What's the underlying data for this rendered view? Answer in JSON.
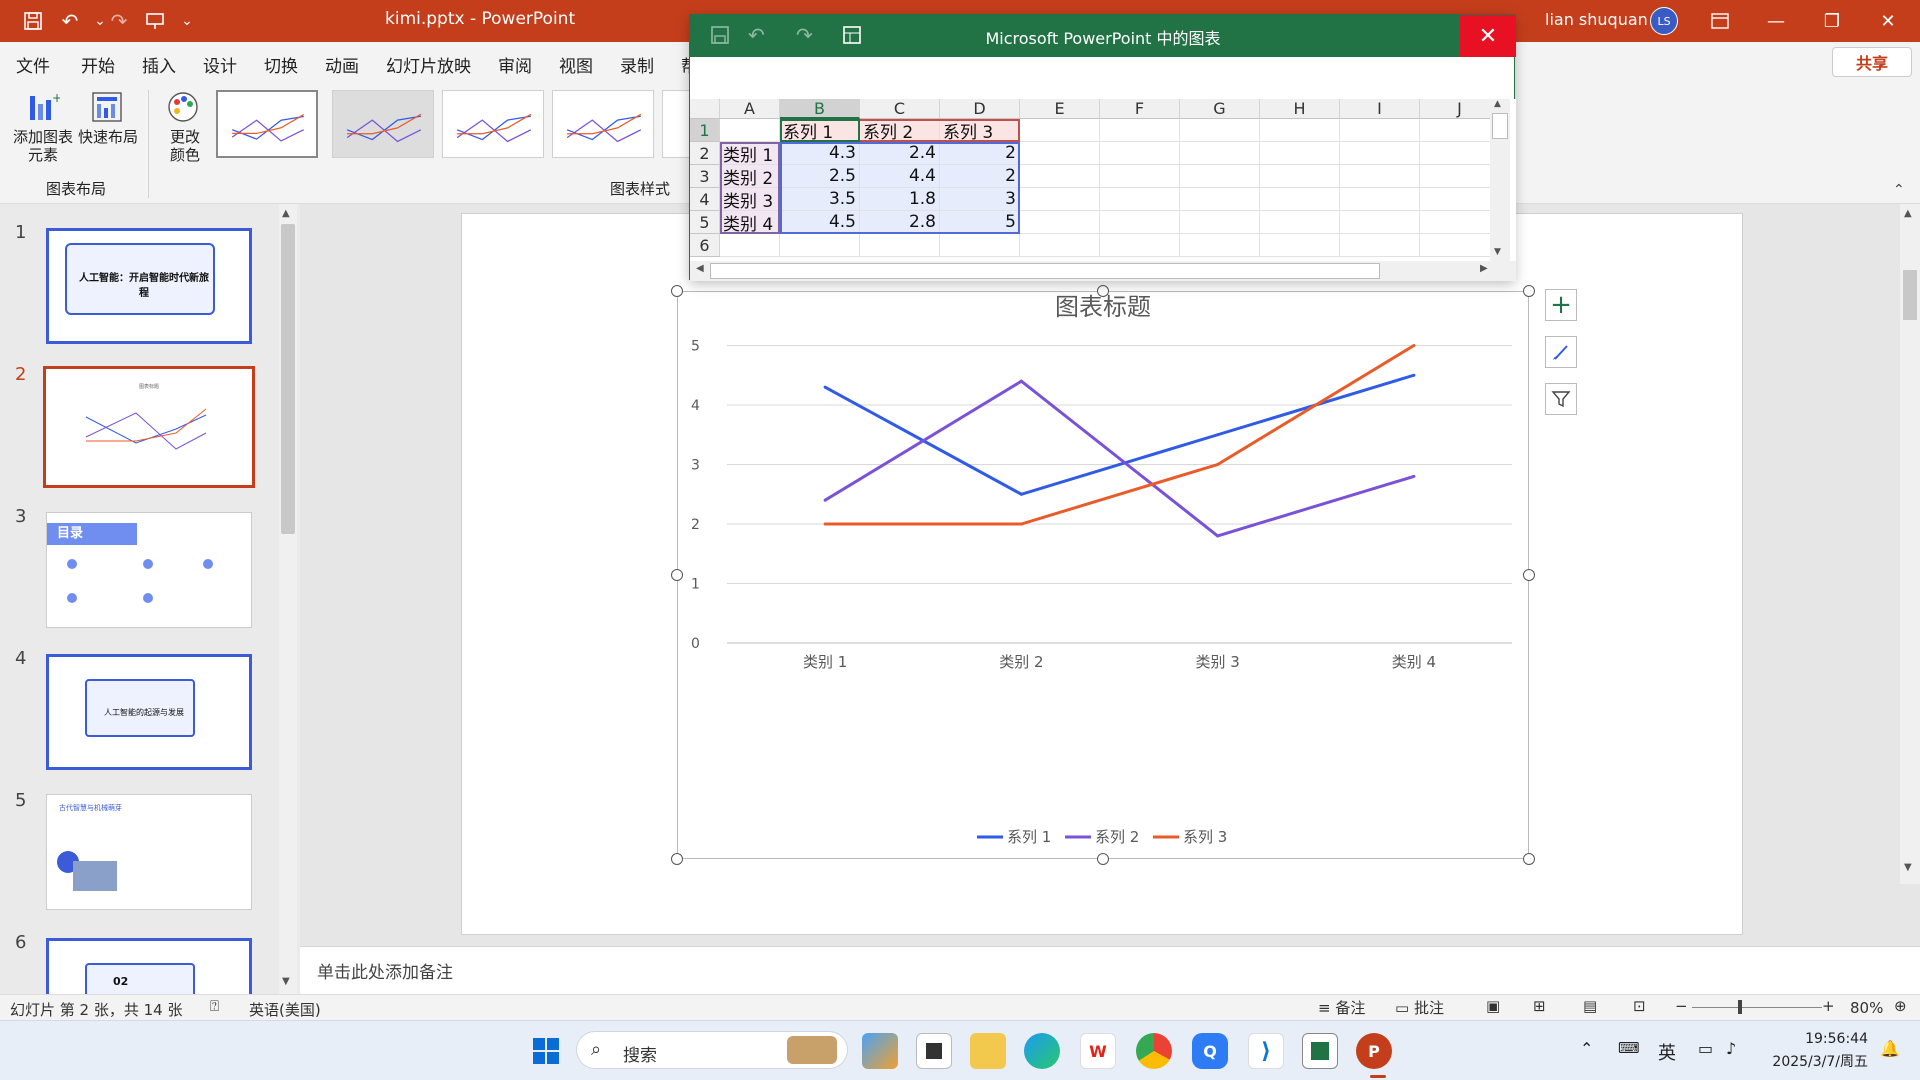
{
  "app": {
    "doc_title": "kimi.pptx  -  PowerPoint",
    "user_name": "lian shuquan",
    "user_initials": "LS",
    "accent": "#c43e1c"
  },
  "menu": [
    "文件",
    "开始",
    "插入",
    "设计",
    "切换",
    "动画",
    "幻灯片放映",
    "审阅",
    "视图",
    "录制",
    "帮"
  ],
  "share_label": "共享",
  "ribbon": {
    "add_element": "添加图表\n元素",
    "quick_layout": "快速布局",
    "change_color": "更改\n颜色",
    "group_layout": "图表布局",
    "group_style": "图表样式"
  },
  "slides": [
    {
      "num": "1",
      "title": "人工智能：开启智能时代新旅程"
    },
    {
      "num": "2",
      "title": "图表标题"
    },
    {
      "num": "3",
      "title": "目录"
    },
    {
      "num": "4",
      "title": "人工智能的起源与发展"
    },
    {
      "num": "5",
      "title": "古代智慧与机械萌芽"
    },
    {
      "num": "6",
      "title": "02"
    }
  ],
  "notes_placeholder": "单击此处添加备注",
  "status": {
    "slide_info": "幻灯片 第 2 张，共 14 张",
    "language": "英语(美国)",
    "notes": "备注",
    "comments": "批注",
    "zoom": "80%"
  },
  "excel": {
    "title": "Microsoft PowerPoint 中的图表",
    "columns": [
      "A",
      "B",
      "C",
      "D",
      "E",
      "F",
      "G",
      "H",
      "I",
      "J"
    ],
    "rows": [
      [
        "",
        "系列 1",
        "系列 2",
        "系列 3"
      ],
      [
        "类别 1",
        "4.3",
        "2.4",
        "2"
      ],
      [
        "类别 2",
        "2.5",
        "4.4",
        "2"
      ],
      [
        "类别 3",
        "3.5",
        "1.8",
        "3"
      ],
      [
        "类别 4",
        "4.5",
        "2.8",
        "5"
      ],
      [
        "",
        "",
        "",
        ""
      ]
    ]
  },
  "chart_data": {
    "type": "line",
    "title": "图表标题",
    "categories": [
      "类别 1",
      "类别 2",
      "类别 3",
      "类别 4"
    ],
    "series": [
      {
        "name": "系列 1",
        "values": [
          4.3,
          2.5,
          3.5,
          4.5
        ],
        "color": "#2f5be7"
      },
      {
        "name": "系列 2",
        "values": [
          2.4,
          4.4,
          1.8,
          2.8
        ],
        "color": "#7a52d8"
      },
      {
        "name": "系列 3",
        "values": [
          2,
          2,
          3,
          5
        ],
        "color": "#ea5b2a"
      }
    ],
    "ylim": [
      0,
      6
    ],
    "yticks": [
      "0",
      "1",
      "2",
      "3",
      "4",
      "5",
      "6"
    ],
    "grid": true,
    "legend": "bottom"
  },
  "taskbar": {
    "search": "搜索",
    "ime": "英",
    "time": "19:56:44",
    "date": "2025/3/7/周五"
  }
}
